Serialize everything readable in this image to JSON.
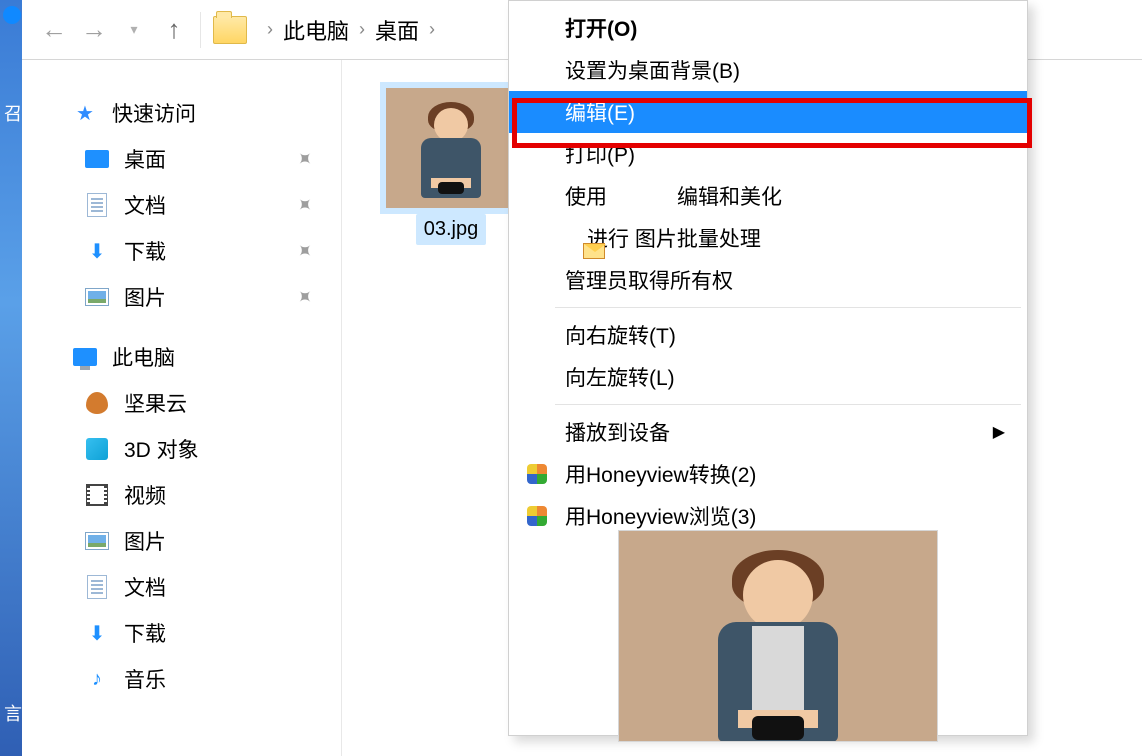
{
  "breadcrumb": {
    "part1": "此电脑",
    "part2": "桌面"
  },
  "sidebar": {
    "quick_access": "快速访问",
    "items": [
      "桌面",
      "文档",
      "下载",
      "图片"
    ],
    "this_pc": "此电脑",
    "pc_items": [
      "坚果云",
      "3D 对象",
      "视频",
      "图片",
      "文档",
      "下载",
      "音乐"
    ]
  },
  "file": {
    "name": "03.jpg"
  },
  "menu": {
    "open": "打开(O)",
    "set_bg": "设置为桌面背景(B)",
    "edit": "编辑(E)",
    "print": "打印(P)",
    "use": "使用",
    "edit_beautify": "编辑和美化",
    "batch": "进行 图片批量处理",
    "admin": "管理员取得所有权",
    "rotate_r": "向右旋转(T)",
    "rotate_l": "向左旋转(L)",
    "cast": "播放到设备",
    "hv_convert": "用Honeyview转换(2)",
    "hv_browse": "用Honeyview浏览(3)"
  }
}
